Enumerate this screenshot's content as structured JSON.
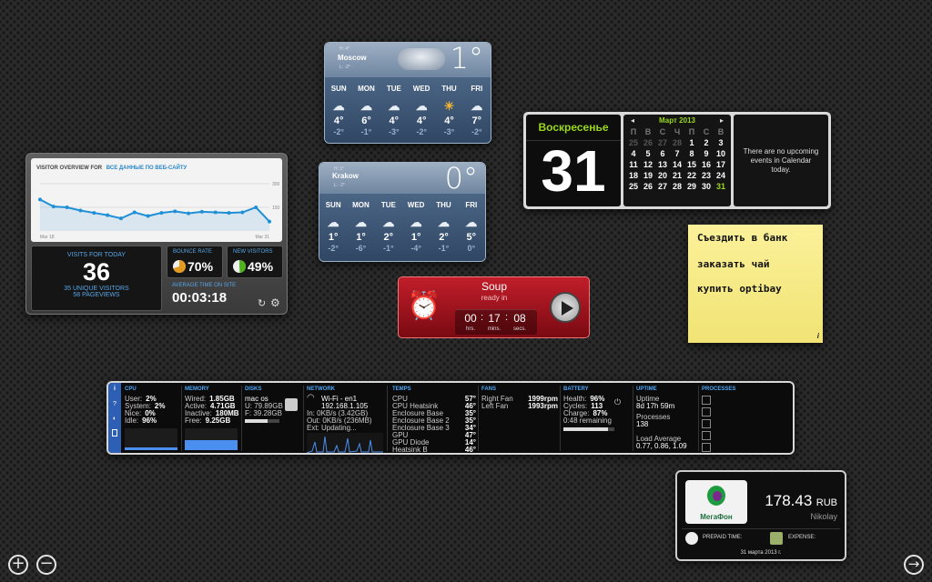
{
  "weather_moscow": {
    "city": "Moscow",
    "hi": "H: 4°",
    "lo": "L: -2°",
    "temp": "1°",
    "days": [
      {
        "d": "SUN",
        "hi": "4°",
        "lo": "-2°",
        "icon": "☁"
      },
      {
        "d": "MON",
        "hi": "6°",
        "lo": "-1°",
        "icon": "☁"
      },
      {
        "d": "TUE",
        "hi": "4°",
        "lo": "-3°",
        "icon": "☁"
      },
      {
        "d": "WED",
        "hi": "4°",
        "lo": "-2°",
        "icon": "☁"
      },
      {
        "d": "THU",
        "hi": "4°",
        "lo": "-3°",
        "icon": "☀"
      },
      {
        "d": "FRI",
        "hi": "7°",
        "lo": "-2°",
        "icon": "☁"
      }
    ]
  },
  "weather_krakow": {
    "city": "Krakow",
    "hi": "H: 1°",
    "lo": "L: -2°",
    "temp": "0°",
    "days": [
      {
        "d": "SUN",
        "hi": "1°",
        "lo": "-2°",
        "icon": "☁"
      },
      {
        "d": "MON",
        "hi": "1°",
        "lo": "-6°",
        "icon": "☁"
      },
      {
        "d": "TUE",
        "hi": "2°",
        "lo": "-1°",
        "icon": "☁"
      },
      {
        "d": "WED",
        "hi": "1°",
        "lo": "-4°",
        "icon": "☁"
      },
      {
        "d": "THU",
        "hi": "2°",
        "lo": "-1°",
        "icon": "☁"
      },
      {
        "d": "FRI",
        "hi": "5°",
        "lo": "0°",
        "icon": "☁"
      }
    ]
  },
  "visitors": {
    "title": "VISITOR OVERVIEW FOR",
    "site": "ВСЕ ДАННЫЕ ПО ВЕБ-САЙТУ",
    "chart_data": {
      "type": "line",
      "x": [
        1,
        2,
        3,
        4,
        5,
        6,
        7,
        8,
        9,
        10,
        11,
        12,
        13,
        14,
        15,
        16,
        17,
        18
      ],
      "values": [
        200,
        155,
        150,
        130,
        115,
        100,
        80,
        118,
        95,
        115,
        125,
        112,
        122,
        118,
        115,
        118,
        150,
        60
      ],
      "ylim": [
        0,
        300
      ],
      "y_ticks": [
        "300",
        "150"
      ],
      "x_labels": [
        "Mar 18",
        "Mar 31"
      ],
      "color": "#1f8fd6"
    },
    "visits_label": "VISITS FOR TODAY",
    "visits": "36",
    "unique": "35 UNIQUE VISITORS",
    "pageviews": "58 PAGEVIEWS",
    "bounce_label": "BOUNCE RATE",
    "bounce": "70%",
    "bounce_frac": 0.7,
    "new_label": "NEW VISITORS",
    "new": "49%",
    "new_frac": 0.49,
    "avg_label": "AVERAGE TIME ON SITE",
    "avg": "00:03:18"
  },
  "calendar": {
    "weekday": "Воскресенье",
    "day": "31",
    "month": "Март 2013",
    "prev": "◂",
    "next": "▸",
    "headers": [
      "П",
      "В",
      "С",
      "Ч",
      "П",
      "С",
      "В"
    ],
    "cells": [
      [
        "25",
        0
      ],
      [
        "26",
        0
      ],
      [
        "27",
        0
      ],
      [
        "28",
        0
      ],
      [
        "1",
        1
      ],
      [
        "2",
        1
      ],
      [
        "3",
        1
      ],
      [
        "4",
        1
      ],
      [
        "5",
        1
      ],
      [
        "6",
        1
      ],
      [
        "7",
        1
      ],
      [
        "8",
        1
      ],
      [
        "9",
        1
      ],
      [
        "10",
        1
      ],
      [
        "11",
        1
      ],
      [
        "12",
        1
      ],
      [
        "13",
        1
      ],
      [
        "14",
        1
      ],
      [
        "15",
        1
      ],
      [
        "16",
        1
      ],
      [
        "17",
        1
      ],
      [
        "18",
        1
      ],
      [
        "19",
        1
      ],
      [
        "20",
        1
      ],
      [
        "21",
        1
      ],
      [
        "22",
        1
      ],
      [
        "23",
        1
      ],
      [
        "24",
        1
      ],
      [
        "25",
        1
      ],
      [
        "26",
        1
      ],
      [
        "27",
        1
      ],
      [
        "28",
        1
      ],
      [
        "29",
        1
      ],
      [
        "30",
        1
      ],
      [
        "31",
        2
      ]
    ],
    "events": "There are no upcoming events in Calendar today."
  },
  "note": {
    "lines": [
      "Съездить в банк",
      "заказать чай",
      "купить optibay"
    ],
    "info": "i"
  },
  "soup": {
    "title": "Soup",
    "subtitle": "ready in",
    "h": "00",
    "m": "17",
    "s": "08",
    "hl": "hrs.",
    "ml": "mins.",
    "sl": "secs."
  },
  "istat": {
    "cpu": {
      "h": "CPU",
      "rows": [
        [
          "User:",
          "2%"
        ],
        [
          "System:",
          "2%"
        ],
        [
          "Nice:",
          "0%"
        ],
        [
          "Idle:",
          "96%"
        ]
      ]
    },
    "memory": {
      "h": "MEMORY",
      "rows": [
        [
          "Wired:",
          "1.85GB"
        ],
        [
          "Active:",
          "4.71GB"
        ],
        [
          "Inactive:",
          "180MB"
        ],
        [
          "Free:",
          "9.25GB"
        ]
      ]
    },
    "disks": {
      "h": "DISKS",
      "name": "mac os",
      "used": "U: 79.89GB",
      "free": "F: 39.28GB",
      "used_frac": 0.67
    },
    "network": {
      "h": "NETWORK",
      "iface": "Wi-Fi - en1",
      "ip": "192.168.1.105",
      "in": "In: 0KB/s (3.42GB)",
      "out": "Out: 0KB/s (236MB)",
      "ext": "Ext: Updating..."
    },
    "temps": {
      "h": "TEMPS",
      "rows": [
        [
          "CPU",
          "57°"
        ],
        [
          "CPU Heatsink",
          "46°"
        ],
        [
          "Enclosure Base",
          "35°"
        ],
        [
          "Enclosure Base 2",
          "35°"
        ],
        [
          "Enclosure Base 3",
          "34°"
        ],
        [
          "GPU",
          "47°"
        ],
        [
          "GPU Diode",
          "14°"
        ],
        [
          "Heatsink B",
          "46°"
        ]
      ]
    },
    "fans": {
      "h": "FANS",
      "rows": [
        [
          "Right Fan",
          "1999rpm"
        ],
        [
          "Left Fan",
          "1993rpm"
        ]
      ]
    },
    "battery": {
      "h": "BATTERY",
      "rows": [
        [
          "Health:",
          "96%"
        ],
        [
          "Cycles:",
          "113"
        ],
        [
          "Charge:",
          "87%"
        ],
        [
          "0:48 remaining",
          ""
        ]
      ],
      "charge_frac": 0.87
    },
    "uptime": {
      "h": "UPTIME",
      "uptime_l": "Uptime",
      "uptime": "8d 17h 59m",
      "proc_l": "Processes",
      "proc": "138",
      "load_l": "Load Average",
      "load": "0.77, 0.86, 1.09"
    },
    "processes": {
      "h": "PROCESSES"
    },
    "cpu_frac": 0.04,
    "mem_frac": 0.45
  },
  "megafon": {
    "logo": "МегаФон",
    "amount": "178.43",
    "currency": "RUB",
    "name": "Nikolay",
    "prepaid": "PREPAID TIME:",
    "expense": "EXPENSE:",
    "date": "31 марта 2013 г."
  },
  "controls": {
    "add": "+",
    "remove": "−",
    "next": "→"
  }
}
